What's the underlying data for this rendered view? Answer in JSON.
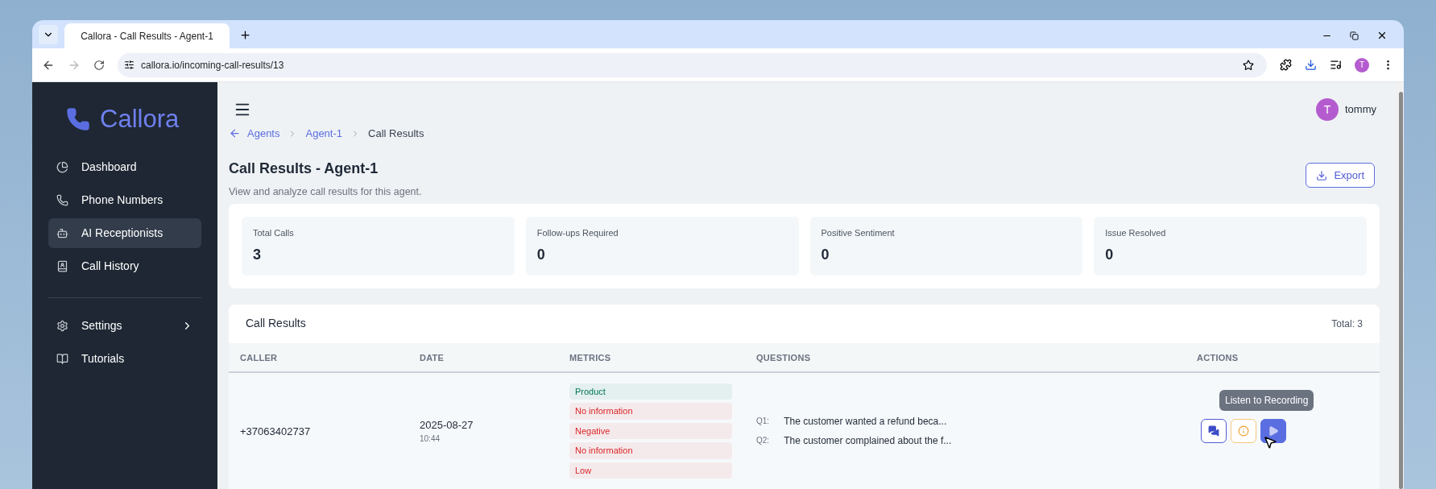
{
  "browser": {
    "tab_title": "Callora - Call Results - Agent-1",
    "url": "callora.io/incoming-call-results/13",
    "profile_initial": "T"
  },
  "sidebar": {
    "brand": "Callora",
    "items": [
      {
        "label": "Dashboard",
        "selected": false
      },
      {
        "label": "Phone Numbers",
        "selected": false
      },
      {
        "label": "AI Receptionists",
        "selected": true
      },
      {
        "label": "Call History",
        "selected": false
      }
    ],
    "bottom_items": [
      {
        "label": "Settings",
        "has_submenu": true
      },
      {
        "label": "Tutorials",
        "has_submenu": false
      }
    ]
  },
  "header": {
    "user_initial": "T",
    "user_name": "tommy"
  },
  "breadcrumb": [
    {
      "label": "Agents",
      "link": true
    },
    {
      "label": "Agent-1",
      "link": true
    },
    {
      "label": "Call Results",
      "link": false
    }
  ],
  "page": {
    "title": "Call Results - Agent-1",
    "subtitle": "View and analyze call results for this agent.",
    "export_label": "Export"
  },
  "stats": [
    {
      "label": "Total Calls",
      "value": "3"
    },
    {
      "label": "Follow-ups Required",
      "value": "0"
    },
    {
      "label": "Positive Sentiment",
      "value": "0"
    },
    {
      "label": "Issue Resolved",
      "value": "0"
    }
  ],
  "table": {
    "title": "Call Results",
    "total": "Total: 3",
    "columns": [
      "CALLER",
      "DATE",
      "METRICS",
      "QUESTIONS",
      "ACTIONS"
    ],
    "rows": [
      {
        "caller": "+37063402737",
        "date": "2025-08-27",
        "time": "10:44",
        "metrics": [
          {
            "label": "Product",
            "color": "#047857"
          },
          {
            "label": "No information",
            "color": "#dc2626"
          },
          {
            "label": "Negative",
            "color": "#dc2626"
          },
          {
            "label": "No information",
            "color": "#dc2626"
          },
          {
            "label": "Low",
            "color": "#dc2626"
          }
        ],
        "questions": [
          {
            "number": "Q1:",
            "text": "The customer wanted a refund beca..."
          },
          {
            "number": "Q2:",
            "text": "The customer complained about the f..."
          }
        ],
        "actions": [
          {
            "kind": "chat",
            "hovered": false
          },
          {
            "kind": "info",
            "hovered": false
          },
          {
            "kind": "play",
            "hovered": true
          }
        ],
        "tooltip": "Listen to Recording"
      }
    ]
  }
}
